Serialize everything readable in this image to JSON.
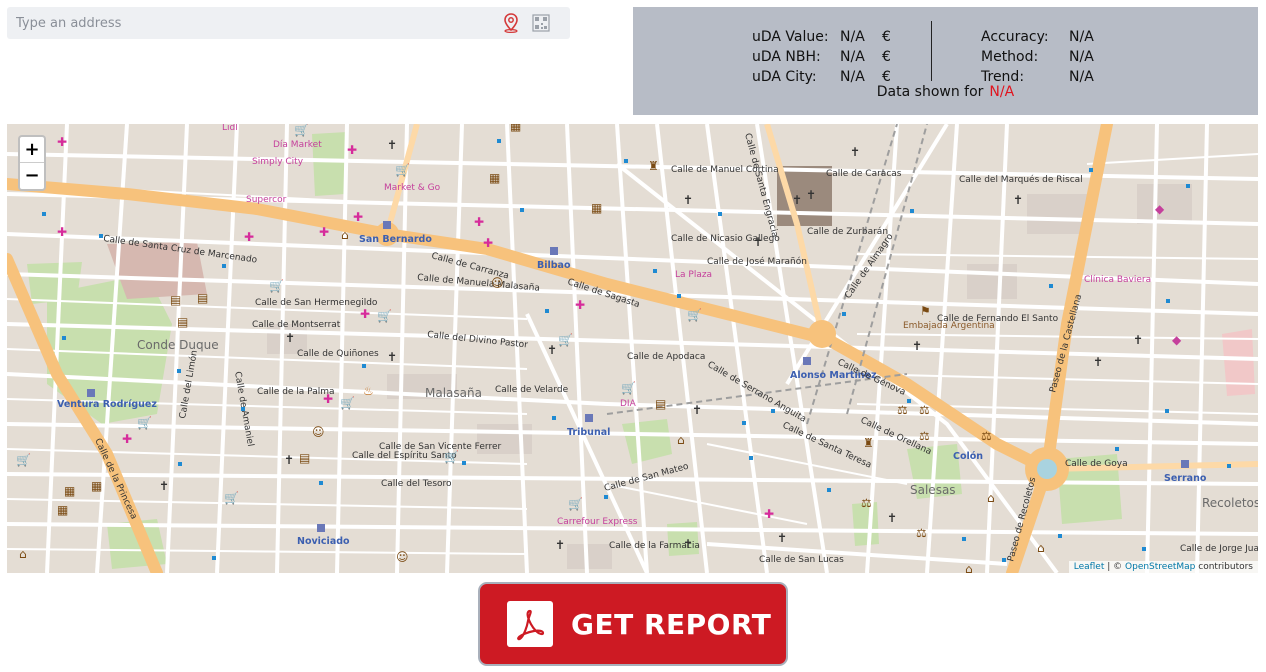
{
  "address": {
    "placeholder": "Type an address"
  },
  "info": {
    "left": [
      {
        "label": "uDA Value:",
        "value": "N/A",
        "unit": "€"
      },
      {
        "label": "uDA NBH:",
        "value": "N/A",
        "unit": "€"
      },
      {
        "label": "uDA City:",
        "value": "N/A",
        "unit": "€"
      }
    ],
    "right": [
      {
        "label": "Accuracy:",
        "value": "N/A"
      },
      {
        "label": "Method:",
        "value": "N/A"
      },
      {
        "label": "Trend:",
        "value": "N/A"
      }
    ],
    "data_shown_label": "Data shown for",
    "data_shown_value": "N/A"
  },
  "map": {
    "zoom_in": "+",
    "zoom_out": "−",
    "attribution_leaflet": "Leaflet",
    "attribution_sep": " | © ",
    "attribution_osm": "OpenStreetMap",
    "attribution_tail": " contributors",
    "districts": [
      "Conde Duque",
      "Malasaña",
      "Salesas"
    ],
    "metro": [
      "San Bernardo",
      "Bilbao",
      "Alonso Martínez",
      "Ventura Rodríguez",
      "Tribunal",
      "Noviciado",
      "Colón",
      "Serrano"
    ],
    "pois": [
      "Día Market",
      "Lidl",
      "Simply City",
      "Supercor",
      "Market & Go",
      "Carrefour Express",
      "La Plaza",
      "DIA",
      "Embajada Argentina",
      "Clínica Baviera",
      "Recoletos"
    ],
    "streets": [
      "Calle de Carranza",
      "Calle de Sagasta",
      "Calle de Génova",
      "Calle de Santa Cruz de Marcenado",
      "Calle de San Hermenegildo",
      "Calle de Montserrat",
      "Calle de Quiñones",
      "Calle del Divino Pastor",
      "Calle de la Palma",
      "Calle de Velarde",
      "Calle de San Vicente Ferrer",
      "Calle del Espíritu Santo",
      "Calle del Tesoro",
      "Calle de Manuela Malasaña",
      "Calle de Apodaca",
      "Calle de Serrano Anguita",
      "Calle de Nicasio Gallego",
      "Calle de José Marañón",
      "Calle de Manuel Cortina",
      "Calle de Caracas",
      "Calle de Zurbarán",
      "Calle del Marqués de Riscal",
      "Calle de Fernando El Santo",
      "Calle de Goya",
      "Calle de Jorge Juan",
      "Calle de San Mateo",
      "Calle de la Farmacia",
      "Calle de San Lucas",
      "Calle de Santa Teresa",
      "Calle de Orellana",
      "Calle de la Princesa",
      "Paseo de la Castellana",
      "Paseo de Recoletos",
      "Calle de Santa Engracia",
      "Calle de Almagro",
      "Calle del Limón",
      "Calle de Amaniel"
    ]
  },
  "report": {
    "label": "GET REPORT"
  },
  "colors": {
    "accent": "#cd1a23",
    "na_value": "#e0141e",
    "panel_bg": "#b7bcc6"
  }
}
